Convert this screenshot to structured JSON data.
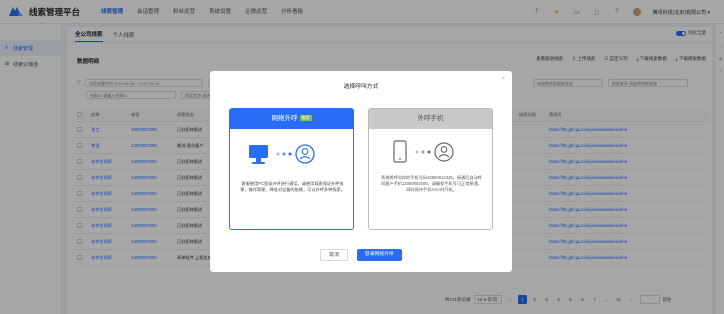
{
  "app": {
    "title": "线索管理平台"
  },
  "topnav": [
    "线索管理",
    "会话管理",
    "粉丝运营",
    "系统设置",
    "企微运营",
    "分析看板"
  ],
  "user": {
    "company": "腾讯科技(北京)有限公司 ▾"
  },
  "sidebar": [
    {
      "label": "线索管理",
      "icon": "list-icon"
    },
    {
      "label": "线索公海池",
      "icon": "pool-icon"
    }
  ],
  "tabs": [
    "全公司线索",
    "个人线索"
  ],
  "data_toggle": "线索全量",
  "section_title": "数据明细",
  "toolbar": [
    "查看跟进线索",
    "↥ 上传线索",
    "☷ 自定义列",
    "⤓ 下载线索数据",
    "⤓ 下载模板数据"
  ],
  "filters": {
    "row1": [
      "线索创建时间  2022-06-26  ~  2022-06-19",
      "线索来源  请选择线索来源",
      "请选择线索跟进状态",
      "线索来源  请选择线索来源"
    ],
    "row2": [
      "线索ID  请输入线索ID",
      "线索状态  请选择"
    ]
  },
  "table": {
    "headers": [
      "",
      "名称",
      "电话",
      "线索状态",
      "线索来源",
      "广告ID",
      "广告账户",
      "线索分配",
      "落地页"
    ],
    "rows": [
      [
        "张三",
        "18600002358",
        "已分配待跟进",
        "谨慎待跟进",
        "2",
        "25418",
        "",
        "https://h5.gdt.qq.com/ipwieaa/wieeeex/ma"
      ],
      [
        "李强",
        "13600002358",
        "跟进-意向客户",
        "谨慎待跟进",
        "2",
        "25418",
        "",
        "https://h5.gdt.qq.com/ipwieaa/wieeeex/ma"
      ],
      [
        "未命名线索",
        "13000002000",
        "已分配待跟进",
        "谨慎待跟进",
        "2",
        "25418",
        "",
        "https://h5.gdt.qq.com/ipwieaa/wieeeex/ma"
      ],
      [
        "未命名线索",
        "13000002000",
        "已分配待跟进",
        "谨慎待跟进",
        "2",
        "25418",
        "",
        "https://h5.gdt.qq.com/ipwieaa/wieeeex/ma"
      ],
      [
        "未命名线索",
        "13000002000",
        "已分配待跟进",
        "谨慎待跟进",
        "2",
        "25418",
        "",
        "https://h5.gdt.qq.com/ipwieaa/wieeeex/ma"
      ],
      [
        "未命名线索",
        "13000002000",
        "已分配待跟进",
        "谨慎待跟进",
        "2",
        "25418",
        "",
        "https://h5.gdt.qq.com/ipwieaa/wieeeex/ma"
      ],
      [
        "未命名线索",
        "13000002000",
        "已分配待跟进",
        "谨慎待跟进",
        "2",
        "25418",
        "",
        "https://h5.gdt.qq.com/ipwieaa/wieeeex/ma"
      ],
      [
        "未命名线索",
        "13000002000",
        "已分配待跟进",
        "谨慎待跟进",
        "2",
        "25418",
        "",
        "https://h5.gdt.qq.com/ipwieaa/wieeeex/ma"
      ],
      [
        "未命名线索",
        "13000002000",
        "表单组件  上报白皮书",
        "谨慎待跟进",
        "2",
        "25418",
        "",
        "https://h5.gdt.qq.com/ipwieaa/wieeeex/ma"
      ]
    ]
  },
  "pager": {
    "total": "共101条记录",
    "size": "10 ▾ 条/页",
    "pages": [
      "1",
      "2",
      "3",
      "4",
      "5",
      "6",
      "7",
      "…",
      "11"
    ],
    "jump": "前往"
  },
  "modal": {
    "title": "选择呼叫方式",
    "card_a": {
      "title": "网络外呼",
      "badge": "推荐",
      "desc": "客服使用PC登录外呼进行通话，请使用耳麦保证外呼效果，操作简便，降低对设备的依赖，可以外呼多种线索。"
    },
    "card_b": {
      "title": "外呼手机",
      "desc": "系统将呼叫你的手机号码18600012345，接通后自动呼叫客户手机13000002000，请确保手机号可正常接通，同时保持手机24小时开机。"
    },
    "cancel": "取消",
    "confirm": "登录网络外呼"
  }
}
